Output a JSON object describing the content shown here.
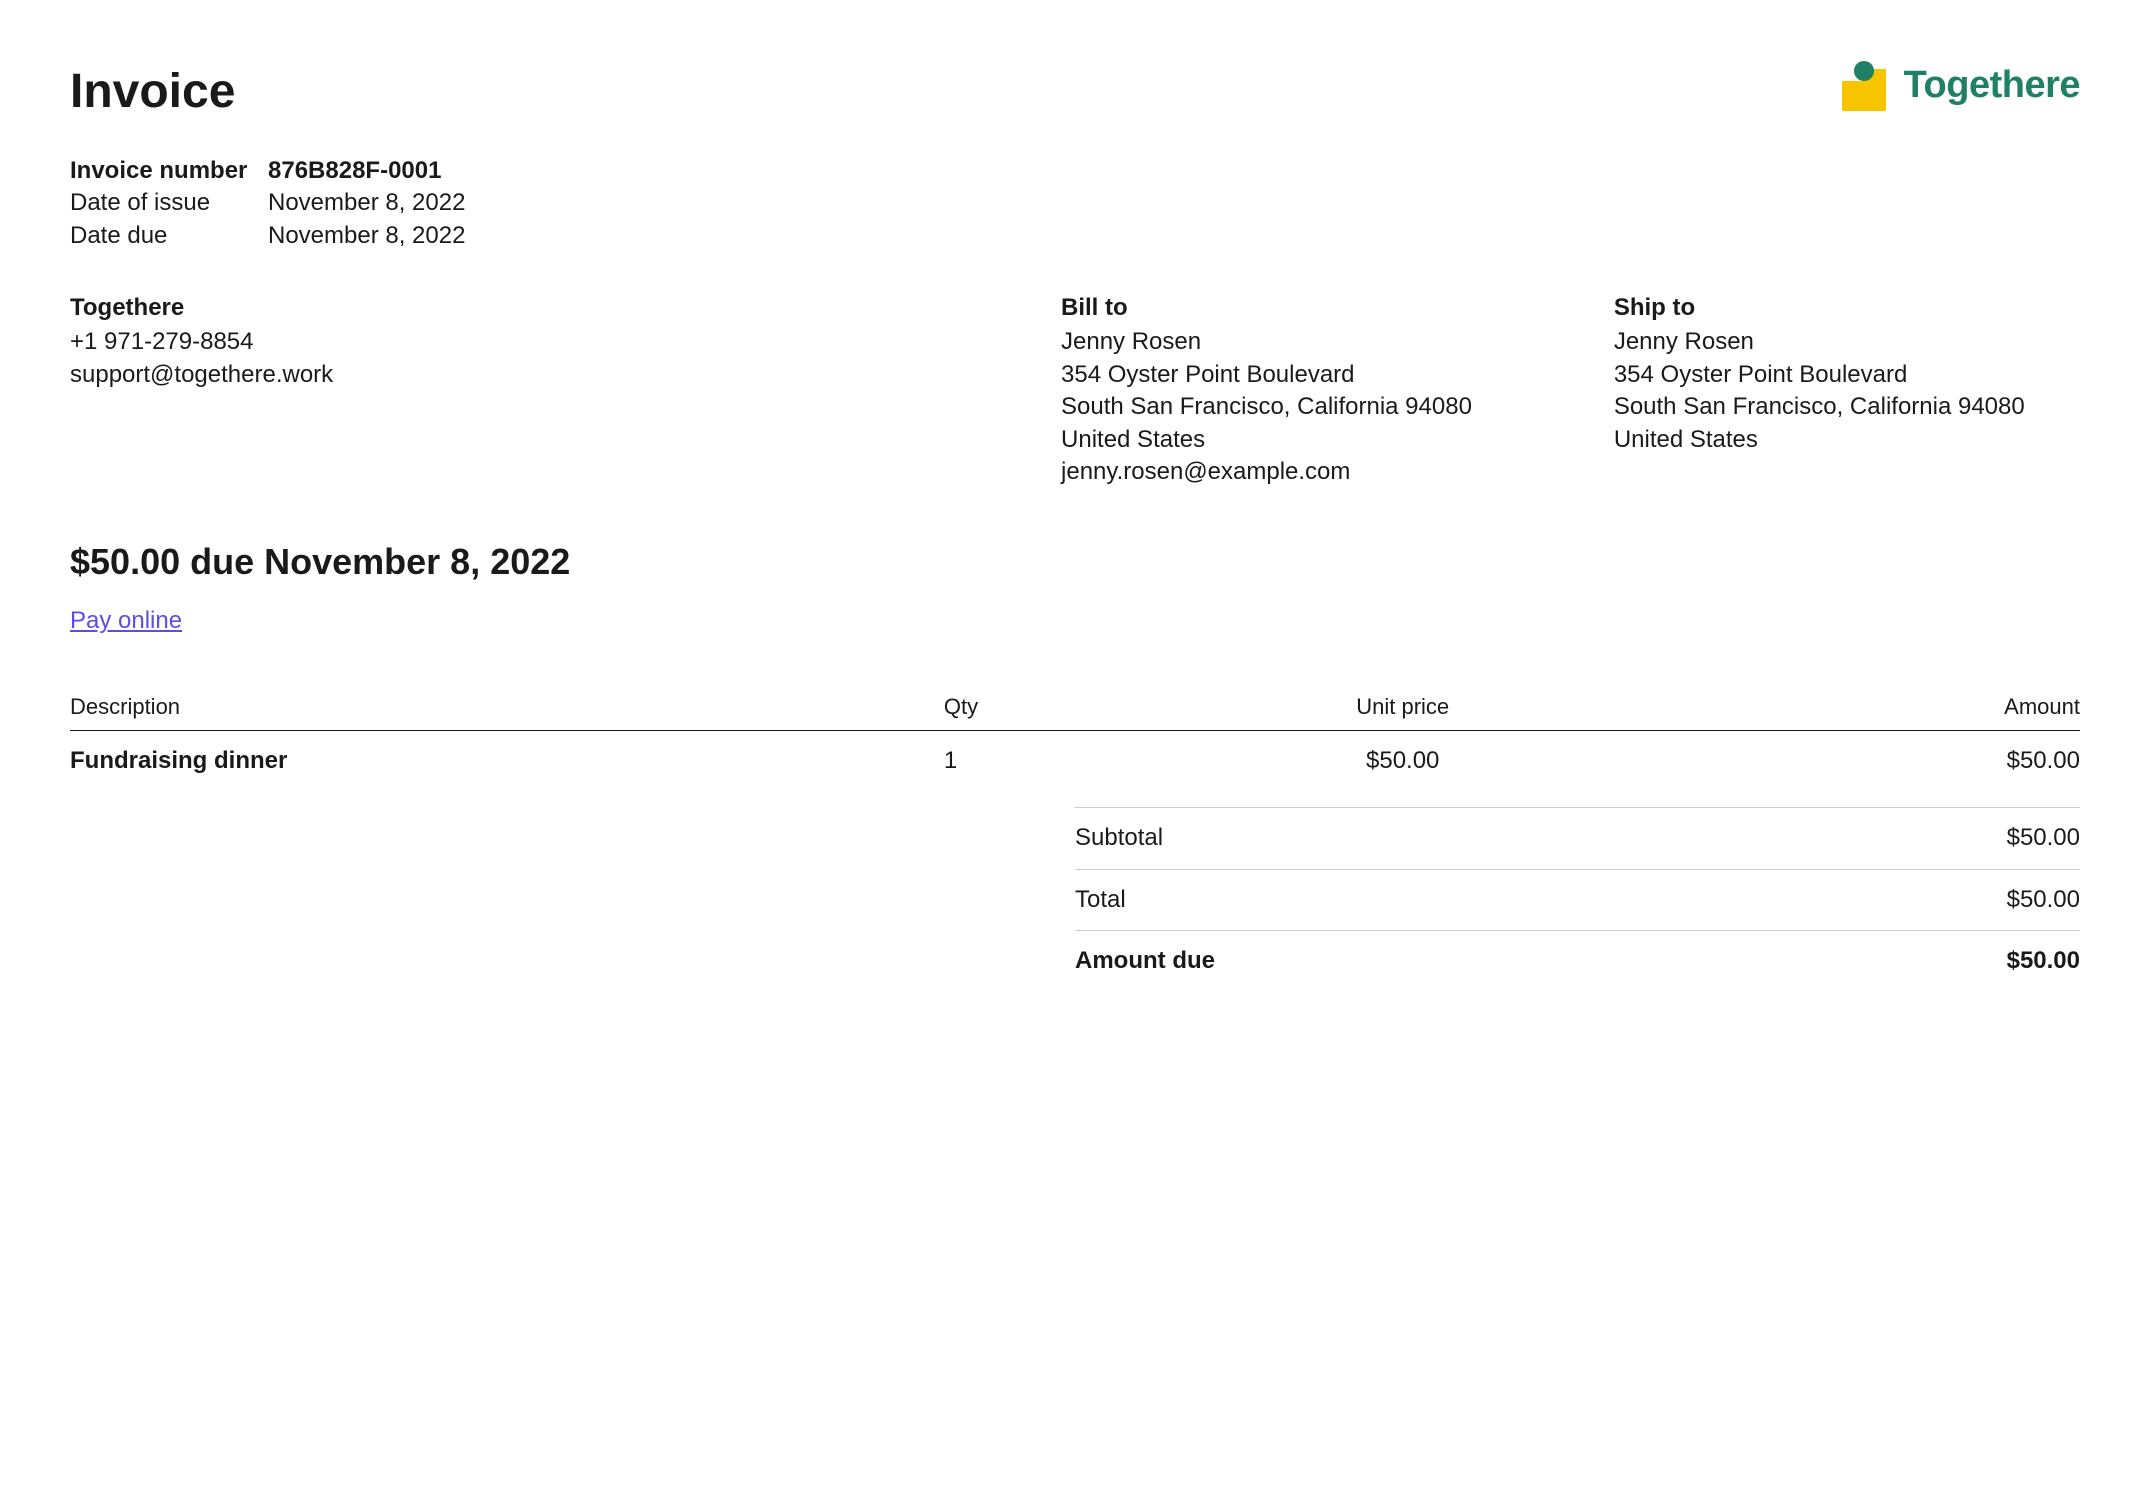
{
  "title": "Invoice",
  "brand": {
    "name": "Togethere"
  },
  "meta": {
    "invoice_number_label": "Invoice number",
    "invoice_number": "876B828F-0001",
    "date_of_issue_label": "Date of issue",
    "date_of_issue": "November 8, 2022",
    "date_due_label": "Date due",
    "date_due": "November 8, 2022"
  },
  "from": {
    "name": "Togethere",
    "phone": "+1 971-279-8854",
    "email": "support@togethere.work"
  },
  "bill_to": {
    "heading": "Bill to",
    "name": "Jenny Rosen",
    "street": "354 Oyster Point Boulevard",
    "city_line": "South San Francisco, California 94080",
    "country": "United States",
    "email": "jenny.rosen@example.com"
  },
  "ship_to": {
    "heading": "Ship to",
    "name": "Jenny Rosen",
    "street": "354 Oyster Point Boulevard",
    "city_line": "South San Francisco, California 94080",
    "country": "United States"
  },
  "summary": "$50.00 due November 8, 2022",
  "pay_online_label": "Pay online",
  "table": {
    "headers": {
      "description": "Description",
      "qty": "Qty",
      "unit_price": "Unit price",
      "amount": "Amount"
    },
    "row": {
      "description": "Fundraising dinner",
      "qty": "1",
      "unit_price": "$50.00",
      "amount": "$50.00"
    }
  },
  "totals": {
    "subtotal_label": "Subtotal",
    "subtotal": "$50.00",
    "total_label": "Total",
    "total": "$50.00",
    "amount_due_label": "Amount due",
    "amount_due": "$50.00"
  }
}
